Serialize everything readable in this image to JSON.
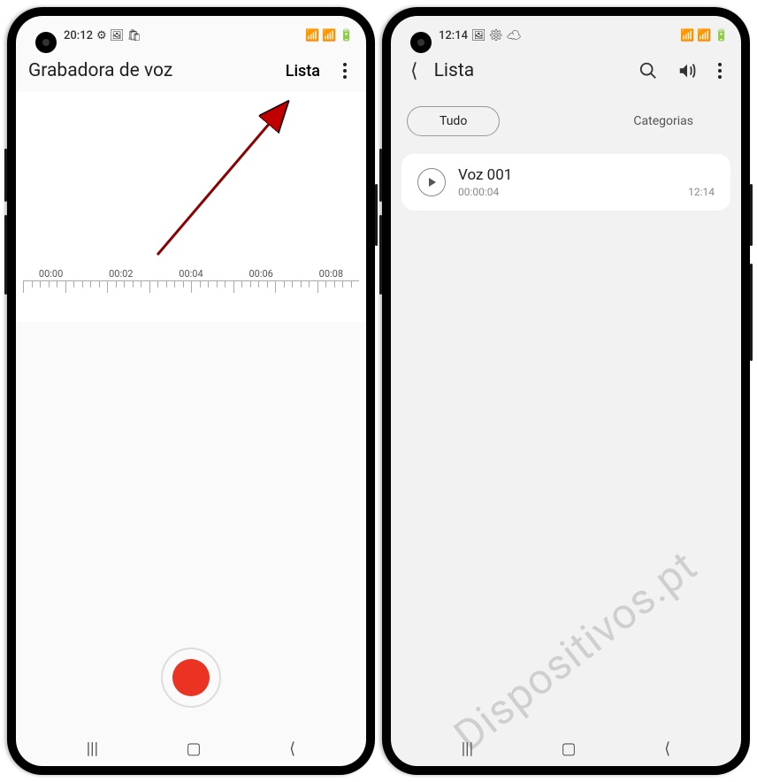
{
  "phone1": {
    "status": {
      "time": "20:12",
      "icons_left": "⚙ 🖼 🛍",
      "icons_right": "📶 📶 🔋"
    },
    "header": {
      "title": "Grabadora de voz",
      "list_btn": "Lista"
    },
    "timeline": {
      "t0": "00:00",
      "t1": "00:02",
      "t2": "00:04",
      "t3": "00:06",
      "t4": "00:08"
    }
  },
  "phone2": {
    "status": {
      "time": "12:14",
      "icons_left": "🖼 ⚙ ☁",
      "icons_right": "📶 📶 🔋"
    },
    "header": {
      "title": "Lista"
    },
    "tabs": {
      "all": "Tudo",
      "categories": "Categorias"
    },
    "recordings": [
      {
        "title": "Voz 001",
        "duration": "00:00:04",
        "time": "12:14"
      }
    ]
  },
  "watermark": "Dispositivos.pt"
}
